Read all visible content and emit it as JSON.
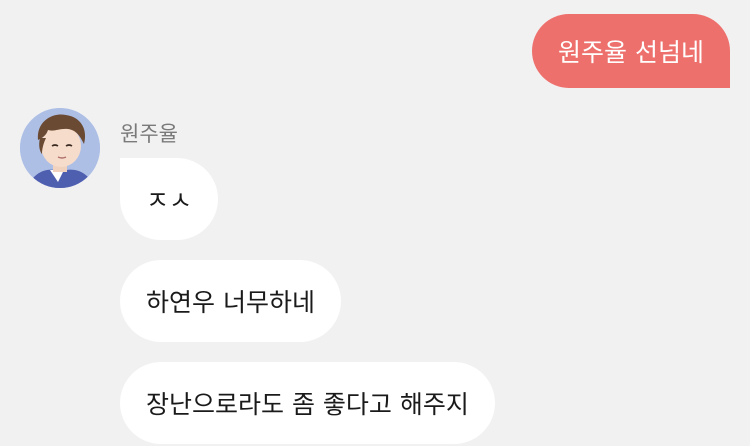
{
  "outgoing": {
    "message": "원주율 선넘네"
  },
  "incoming": {
    "sender_name": "원주율",
    "avatar": "profile-avatar-illustration",
    "messages": [
      {
        "text": "ㅈㅅ"
      },
      {
        "text": "하연우 너무하네"
      },
      {
        "text": "장난으로라도 좀 좋다고 해주지"
      }
    ]
  },
  "colors": {
    "background": "#f2f1f2",
    "outgoing_bubble": "#ee706c",
    "incoming_bubble": "#ffffff",
    "sender_name": "#7a7a7a"
  }
}
